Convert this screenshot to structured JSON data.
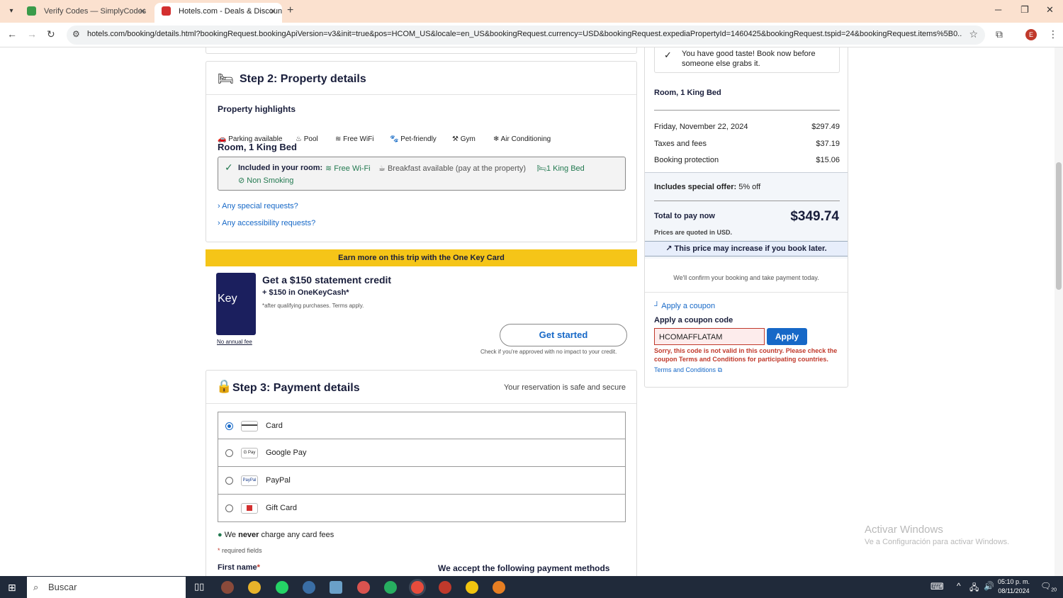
{
  "browser": {
    "tabs": [
      {
        "title": "Verify Codes — SimplyCodes",
        "icon": "simplycodes-favicon"
      },
      {
        "title": "Hotels.com - Deals & Discounts",
        "icon": "hotels-favicon"
      }
    ],
    "url": "hotels.com/booking/details.html?bookingRequest.bookingApiVersion=v3&init=true&pos=HCOM_US&locale=en_US&bookingRequest.currency=USD&bookingRequest.expediaPropertyId=1460425&bookingRequest.tspid=24&bookingRequest.items%5B0...",
    "profile_initial": "E"
  },
  "step2": {
    "title": "Step 2: Property details",
    "highlights_title": "Property highlights",
    "highlights": [
      {
        "label": "Parking available",
        "icon": "car-icon"
      },
      {
        "label": "Pool",
        "icon": "pool-icon"
      },
      {
        "label": "Free WiFi",
        "icon": "wifi-icon"
      },
      {
        "label": "Pet-friendly",
        "icon": "paw-icon"
      },
      {
        "label": "Gym",
        "icon": "dumbbell-icon"
      },
      {
        "label": "Air Conditioning",
        "icon": "snowflake-icon"
      }
    ],
    "room_title": "Room, 1 King Bed",
    "included_label": "Included in your room:",
    "included": [
      "Free Wi-Fi",
      "Breakfast available (pay at the property)",
      "1 King Bed",
      "Non Smoking"
    ],
    "special_requests": "Any special requests?",
    "accessibility_requests": "Any accessibility requests?"
  },
  "onekey": {
    "banner": "Earn more on this trip with the One Key Card",
    "title": "Get a $150 statement credit",
    "plus": "+ $150 in OneKeyCash*",
    "fine": "*after qualifying purchases. Terms apply.",
    "no_fee": "No annual fee",
    "button": "Get started",
    "check": "Check if you're approved with no impact to your credit.",
    "card_text": "Key"
  },
  "step3": {
    "title": "Step 3: Payment details",
    "secure": "Your reservation is safe and secure",
    "options": [
      {
        "label": "Card",
        "selected": true,
        "logo": ""
      },
      {
        "label": "Google Pay",
        "selected": false,
        "logo": "G Pay"
      },
      {
        "label": "PayPal",
        "selected": false,
        "logo": "PayPal"
      },
      {
        "label": "Gift Card",
        "selected": false,
        "logo": ""
      }
    ],
    "never_fees_pre": "We",
    "never_fees_bold": "never",
    "never_fees_post": "charge any card fees",
    "required": "required fields",
    "required_star": "*",
    "first_name": "First name",
    "accept": "We accept the following payment methods"
  },
  "summary": {
    "good_taste": "You have good taste! Book now before someone else grabs it.",
    "room": "Room, 1 King Bed",
    "lines": [
      {
        "label": "Friday, November 22, 2024",
        "value": "$297.49"
      },
      {
        "label": "Taxes and fees",
        "value": "$37.19"
      },
      {
        "label": "Booking protection",
        "value": "$15.06"
      }
    ],
    "offer_label": "Includes special offer:",
    "offer_value": "5% off",
    "total_label": "Total to pay now",
    "total_value": "$349.74",
    "currency_note": "Prices are quoted in USD.",
    "increase": "This price may increase if you book later.",
    "confirm": "We'll confirm your booking and take payment today.",
    "apply_coupon_link": "Apply a coupon",
    "coupon_title": "Apply a coupon code",
    "coupon_value": "HCOMAFFLATAM",
    "apply_button": "Apply",
    "error": "Sorry, this code is not valid in this country. Please check the coupon Terms and Conditions for participating countries.",
    "terms": "Terms and Conditions"
  },
  "watermark": {
    "title": "Activar Windows",
    "sub": "Ve a Configuración para activar Windows."
  },
  "taskbar": {
    "search": "Buscar",
    "time": "05:10 p. m.",
    "date": "08/11/2024",
    "notif": "20"
  },
  "colors": {
    "brand_blue": "#1668c7",
    "banner_yellow": "#f5c518",
    "error_red": "#c0392b",
    "green": "#227950"
  }
}
